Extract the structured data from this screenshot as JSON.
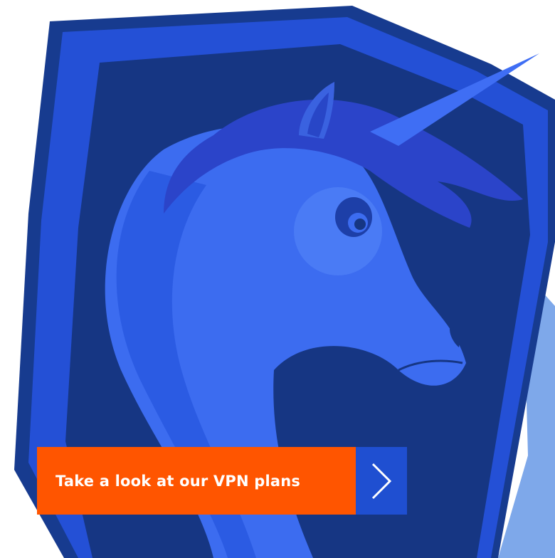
{
  "cta": {
    "label": "Take a look at our VPN plans",
    "arrow_icon": "chevron-right-icon"
  },
  "colors": {
    "shield_outer": "#173b8f",
    "shield_mid": "#2450d6",
    "shield_inner": "#163683",
    "unicorn_light": "#3c6cf0",
    "unicorn_mane": "#2b44c9",
    "cta_orange": "#ff5500",
    "cta_arrow_bg": "#1f4fd1",
    "shadow_light_blue": "#7ea8ea"
  }
}
